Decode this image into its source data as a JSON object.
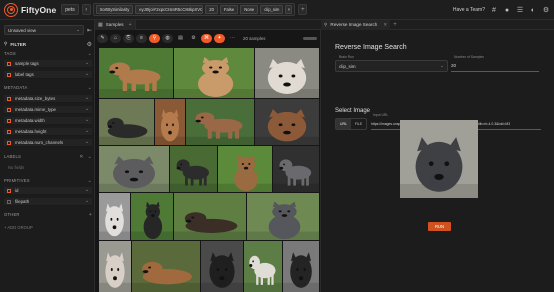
{
  "app": {
    "brand": "FiftyOne",
    "dataset": "pets"
  },
  "view_bar": {
    "stages": [
      "SortBySimilarity",
      "eyJ0IjoiY2xpcCIsInR5cCI6IkpXVCJ9...",
      "20",
      "False",
      "None",
      "clip_sim"
    ],
    "close_symbol": "×"
  },
  "header_right": {
    "have_team": "Have a Team?"
  },
  "sidebar": {
    "view_select": "Unsaved view",
    "filter_title": "FILTER",
    "sections": {
      "tags": "TAGS",
      "metadata": "METADATA",
      "labels": "LABELS",
      "primitives": "PRIMITIVES",
      "other": "OTHER"
    },
    "tags": [
      "sample tags",
      "label tags"
    ],
    "metadata": [
      "metadata.size_bytes",
      "metadata.mime_type",
      "metadata.width",
      "metadata.height",
      "metadata.num_channels"
    ],
    "labels_empty": "No fields",
    "primitives": [
      "id",
      "filepath"
    ],
    "add_group": "+ ADD GROUP"
  },
  "samples_panel": {
    "tab_label": "Samples",
    "count_label": "20 samples"
  },
  "right_panel": {
    "tab_label": "Reverse Image Search",
    "title": "Reverse Image Search",
    "brain_key_label": "Brain Run",
    "brain_key_value": "clip_sim",
    "num_samples_label": "Number of Samples",
    "num_samples_value": "20",
    "select_image_title": "Select Image",
    "source_options": [
      "URL",
      "FILE"
    ],
    "source_selected": "URL",
    "url_label": "Input URL",
    "url_value": "https://images.unsplash.com/photo-1581024670758e-a2093e164e27?ixlib=rb-4.0.3&ixid=M3",
    "run_label": "RUN"
  },
  "colors": {
    "accent": "#f05a28",
    "background": "#1a1a1a",
    "panel": "#1c1c1c"
  },
  "grid_images": [
    {
      "desc": "brown pit bull standing on grass",
      "bg": "#4f7a35",
      "dog": "#b07a4a",
      "type": "standing"
    },
    {
      "desc": "brown and white pit bull sitting",
      "bg": "#5f8a3d",
      "dog": "#c99a6a",
      "type": "sitting"
    },
    {
      "desc": "white pit bull head close up",
      "bg": "#8a8a82",
      "dog": "#e0dad2",
      "type": "head"
    },
    {
      "desc": "black pit bull lying outdoors",
      "bg": "#6e7a55",
      "dog": "#2a2a2a",
      "type": "lying"
    },
    {
      "desc": "brown puppy on brown background",
      "bg": "#8a5a36",
      "dog": "#b57b4c",
      "type": "head"
    },
    {
      "desc": "brown pit bull standing on lawn",
      "bg": "#4a6e3a",
      "dog": "#9a6846",
      "type": "standing"
    },
    {
      "desc": "brown pit bull portrait indoors",
      "bg": "#3c3c3c",
      "dog": "#8c5a38",
      "type": "head"
    },
    {
      "desc": "gray pit bull with red collar",
      "bg": "#7c8a6a",
      "dog": "#5c5c5e",
      "type": "head"
    },
    {
      "desc": "black and white pit bull on grass",
      "bg": "#4a6a34",
      "dog": "#2c2c2c",
      "type": "standing"
    },
    {
      "desc": "brown pit bull in grass",
      "bg": "#5a8a3a",
      "dog": "#9a6a40",
      "type": "sitting"
    },
    {
      "desc": "gray pit bull on dark background",
      "bg": "#303030",
      "dog": "#6a6a6e",
      "type": "standing"
    },
    {
      "desc": "white dog on gray background",
      "bg": "#9a9a9a",
      "dog": "#e2dedc",
      "type": "head"
    },
    {
      "desc": "black and white pit bull in grass",
      "bg": "#4e7a36",
      "dog": "#262626",
      "type": "sitting"
    },
    {
      "desc": "brindle pit bull lying",
      "bg": "#5e7e42",
      "dog": "#3a2e26",
      "type": "lying"
    },
    {
      "desc": "gray pit bull sitting on grass",
      "bg": "#6e8a52",
      "dog": "#55575c",
      "type": "sitting"
    },
    {
      "desc": "white and brown pit bull head",
      "bg": "#9a9a92",
      "dog": "#d8cfc6",
      "type": "head"
    },
    {
      "desc": "brown pit bull lying down",
      "bg": "#5a6a3a",
      "dog": "#a06a3e",
      "type": "lying"
    },
    {
      "desc": "black and white pit bull portrait",
      "bg": "#4a4a4a",
      "dog": "#1f1f1f",
      "type": "head"
    },
    {
      "desc": "white pit bull on grass",
      "bg": "#5c7e46",
      "dog": "#e0dcd6",
      "type": "standing"
    },
    {
      "desc": "black pit bull on gray background",
      "bg": "#7a7a7a",
      "dog": "#242424",
      "type": "head"
    }
  ],
  "preview_image": {
    "desc": "gray pit bull portrait",
    "bg": "#a0a098",
    "dog": "#3e4044",
    "type": "head"
  }
}
